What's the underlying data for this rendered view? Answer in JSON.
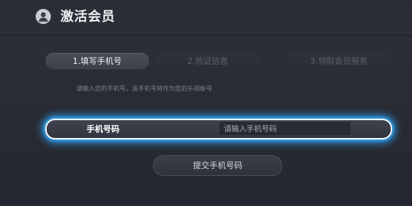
{
  "header": {
    "title": "激活会员",
    "avatar_icon": "user-avatar-icon"
  },
  "steps": [
    {
      "label": "1.填写手机号",
      "state": "active"
    },
    {
      "label": "2.验证信息",
      "state": "inactive"
    },
    {
      "label": "3.领取会员服务",
      "state": "inactive"
    }
  ],
  "hint": "请输入您的手机号，该手机号将作为您的乐视帐号",
  "phone_field": {
    "label": "手机号码",
    "value": "",
    "placeholder": "请输入手机号码"
  },
  "submit_label": "提交手机号码",
  "colors": {
    "focus_glow": "#2aa7ff",
    "background": "#2a2c35"
  }
}
